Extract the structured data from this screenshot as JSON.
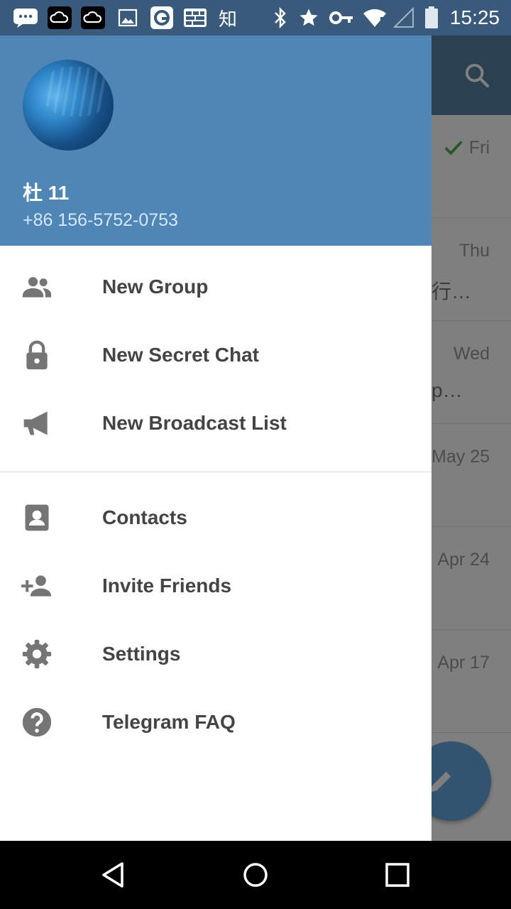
{
  "status_bar": {
    "time": "15:25",
    "zhi_char": "知",
    "icons": [
      "chat-bubble-icon",
      "cloud-icon",
      "cloud-icon",
      "image-icon",
      "browser-icon",
      "grid-icon",
      "zhihu-icon",
      "bluetooth-icon",
      "star-icon",
      "key-icon",
      "wifi-icon",
      "signal-icon",
      "battery-icon"
    ]
  },
  "background_list": {
    "rows": [
      {
        "date": "Fri",
        "snippet": "",
        "sent_check": true
      },
      {
        "date": "Thu",
        "snippet": "行…"
      },
      {
        "date": "Wed",
        "snippet": "p…"
      },
      {
        "date": "May 25",
        "snippet": ""
      },
      {
        "date": "Apr 24",
        "snippet": ""
      },
      {
        "date": "Apr 17",
        "snippet": ""
      }
    ]
  },
  "drawer": {
    "user_name": "杜 11",
    "user_phone": "+86 156-5752-0753",
    "menu_primary": [
      {
        "label": "New Group",
        "icon": "group-icon"
      },
      {
        "label": "New Secret Chat",
        "icon": "lock-icon"
      },
      {
        "label": "New Broadcast List",
        "icon": "megaphone-icon"
      }
    ],
    "menu_secondary": [
      {
        "label": "Contacts",
        "icon": "contact-icon"
      },
      {
        "label": "Invite Friends",
        "icon": "person-add-icon"
      },
      {
        "label": "Settings",
        "icon": "gear-icon"
      },
      {
        "label": "Telegram FAQ",
        "icon": "help-icon"
      }
    ]
  },
  "colors": {
    "header": "#4f86b6",
    "status_bar": "#3a5a7c",
    "icon_gray": "#757575",
    "label_text": "#444444"
  }
}
